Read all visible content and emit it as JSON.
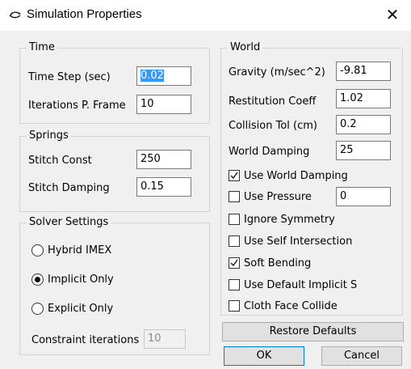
{
  "window": {
    "title": "Simulation Properties",
    "close_glyph": "✕"
  },
  "time": {
    "title": "Time",
    "time_step_label": "Time Step (sec)",
    "time_step_value": "0.02",
    "iterations_label": "Iterations P. Frame",
    "iterations_value": "10"
  },
  "springs": {
    "title": "Springs",
    "stitch_const_label": "Stitch Const",
    "stitch_const_value": "250",
    "stitch_damping_label": "Stitch Damping",
    "stitch_damping_value": "0.15"
  },
  "solver": {
    "title": "Solver Settings",
    "options": [
      {
        "label": "Hybrid IMEX",
        "selected": false
      },
      {
        "label": "Implicit Only",
        "selected": true
      },
      {
        "label": "Explicit Only",
        "selected": false
      }
    ],
    "constraint_label": "Constraint iterations",
    "constraint_value": "10"
  },
  "world": {
    "title": "World",
    "gravity_label": "Gravity (m/sec^2)",
    "gravity_value": "-9.81",
    "restitution_label": "Restitution Coeff",
    "restitution_value": "1.02",
    "collision_label": "Collision Tol (cm)",
    "collision_value": "0.2",
    "damping_label": "World Damping",
    "damping_value": "25",
    "pressure_value": "0",
    "checks": [
      {
        "label": "Use World Damping",
        "checked": true
      },
      {
        "label": "Use Pressure",
        "checked": false
      },
      {
        "label": "Ignore Symmetry",
        "checked": false
      },
      {
        "label": "Use Self Intersection",
        "checked": false
      },
      {
        "label": "Soft Bending",
        "checked": true
      },
      {
        "label": "Use Default Implicit S",
        "checked": false
      },
      {
        "label": "Cloth Face Collide",
        "checked": false
      }
    ]
  },
  "buttons": {
    "restore": "Restore Defaults",
    "ok": "OK",
    "cancel": "Cancel"
  },
  "colors": {
    "selection": "#3399ff",
    "default_button_border": "#0078d7"
  }
}
